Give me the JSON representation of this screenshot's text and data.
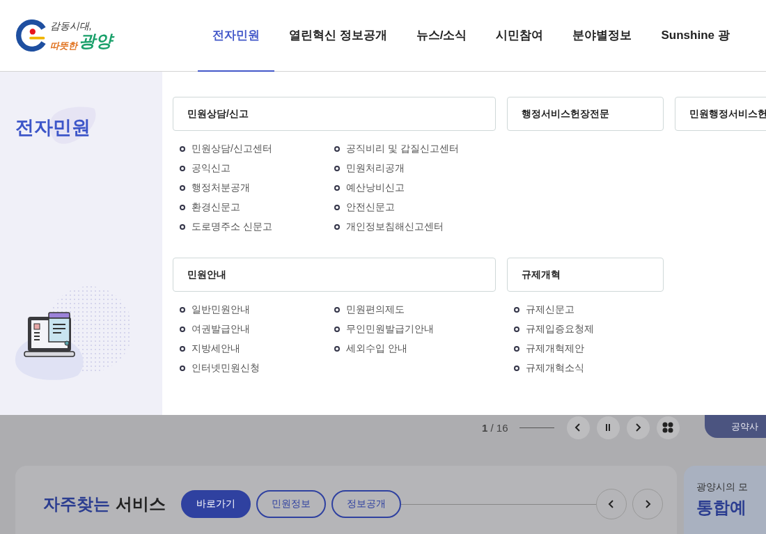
{
  "logo": {
    "line1": "감동시대,",
    "line2": "따뜻한",
    "name": "광양"
  },
  "nav": [
    {
      "label": "전자민원",
      "selected": true
    },
    {
      "label": "열린혁신 정보공개",
      "selected": false
    },
    {
      "label": "뉴스/소식",
      "selected": false
    },
    {
      "label": "시민참여",
      "selected": false
    },
    {
      "label": "분야별정보",
      "selected": false
    },
    {
      "label": "Sunshine 광",
      "selected": false
    }
  ],
  "mega_menu": {
    "title": "전자민원",
    "rows": [
      [
        {
          "title": "민원상담/신고",
          "kind": "wide",
          "columns": [
            [
              "민원상담/신고센터",
              "공익신고",
              "행정처분공개",
              "환경신문고",
              "도로명주소 신문고"
            ],
            [
              "공직비리 및 갑질신고센터",
              "민원처리공개",
              "예산낭비신고",
              "안전신문고",
              "개인정보침해신고센터"
            ]
          ]
        },
        {
          "title": "행정서비스헌장전문",
          "kind": "narrow"
        },
        {
          "title": "민원행정서비스헌",
          "kind": "narrow"
        }
      ],
      [
        {
          "title": "민원안내",
          "kind": "wide",
          "columns": [
            [
              "일반민원안내",
              "여권발급안내",
              "지방세안내",
              "인터넷민원신청"
            ],
            [
              "민원편의제도",
              "무인민원발급기안내",
              "세외수입 안내"
            ]
          ]
        },
        {
          "title": "규제개혁",
          "kind": "narrow",
          "columns": [
            [
              "규제신문고",
              "규제입증요청제",
              "규제개혁제안",
              "규제개혁소식"
            ]
          ]
        }
      ]
    ]
  },
  "slider": {
    "current": "1",
    "total": "/ 16"
  },
  "pledge_button": "공약사",
  "services": {
    "title_accent": "자주찾는",
    "title": "서비스",
    "tabs": [
      {
        "label": "바로가기",
        "selected": true
      },
      {
        "label": "민원정보",
        "selected": false
      },
      {
        "label": "정보공개",
        "selected": false
      }
    ]
  },
  "side_card": {
    "caption": "광양시의 모",
    "heading": "통합예"
  }
}
